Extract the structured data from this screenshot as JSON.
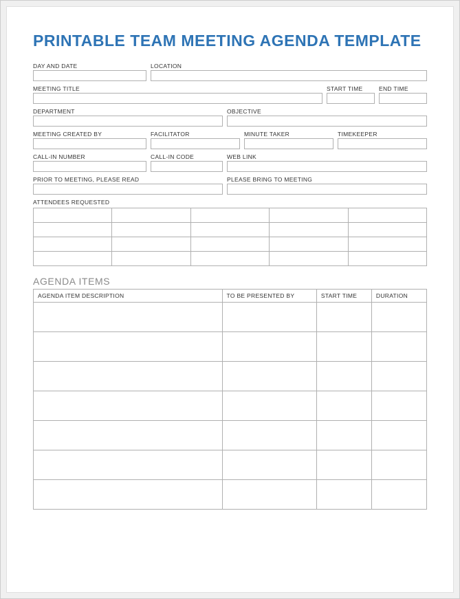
{
  "title": "PRINTABLE TEAM MEETING AGENDA TEMPLATE",
  "fields": {
    "day_date": "DAY AND DATE",
    "location": "LOCATION",
    "meeting_title": "MEETING TITLE",
    "start_time": "START TIME",
    "end_time": "END TIME",
    "department": "DEPARTMENT",
    "objective": "OBJECTIVE",
    "created_by": "MEETING CREATED BY",
    "facilitator": "FACILITATOR",
    "minute_taker": "MINUTE TAKER",
    "timekeeper": "TIMEKEEPER",
    "call_in_number": "CALL-IN NUMBER",
    "call_in_code": "CALL-IN CODE",
    "web_link": "WEB LINK",
    "prior_read": "PRIOR TO MEETING, PLEASE READ",
    "please_bring": "PLEASE BRING TO MEETING",
    "attendees": "ATTENDEES REQUESTED"
  },
  "section_agenda": "AGENDA ITEMS",
  "agenda_columns": {
    "description": "AGENDA ITEM DESCRIPTION",
    "presented_by": "TO BE PRESENTED BY",
    "start_time": "START TIME",
    "duration": "DURATION"
  },
  "attendees_rows": 4,
  "attendees_cols": 5,
  "agenda_rows": 7
}
